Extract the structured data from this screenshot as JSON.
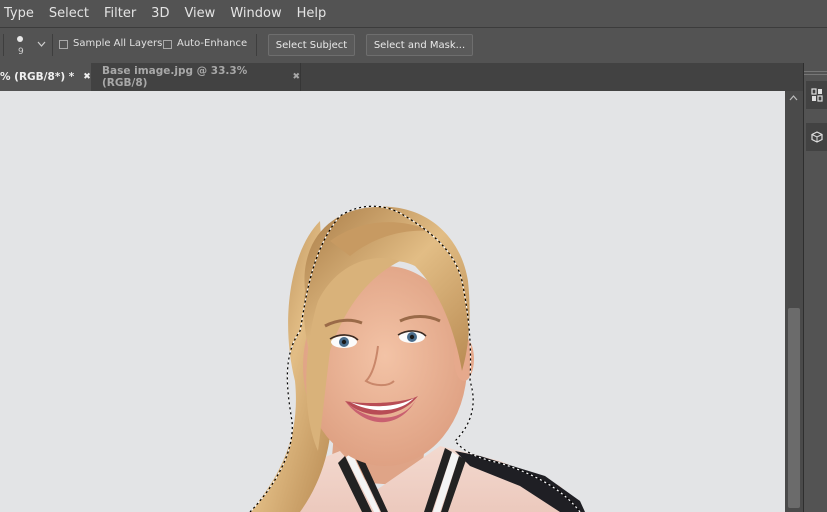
{
  "menubar": {
    "items": [
      "Type",
      "Select",
      "Filter",
      "3D",
      "View",
      "Window",
      "Help"
    ]
  },
  "options": {
    "brush_size": "9",
    "sample_all_layers_label": "Sample All Layers",
    "sample_all_layers_checked": false,
    "auto_enhance_label": "Auto-Enhance",
    "auto_enhance_checked": false,
    "select_subject_label": "Select Subject",
    "select_and_mask_label": "Select and Mask..."
  },
  "tabs": [
    {
      "label": "% (RGB/8*) *",
      "active": true
    },
    {
      "label": "Base image.jpg @ 33.3% (RGB/8)",
      "active": false
    }
  ],
  "colors": {
    "canvas_bg": "#e3e4e6",
    "ui_bg": "#535353",
    "tab_inactive": "#424242"
  },
  "icons": {
    "close": "close-icon",
    "chevron": "chevron-down-icon",
    "scroll_up": "scroll-up-arrow-icon",
    "panel_layers": "panel-arrange-icon",
    "panel_3d": "cube-icon"
  }
}
